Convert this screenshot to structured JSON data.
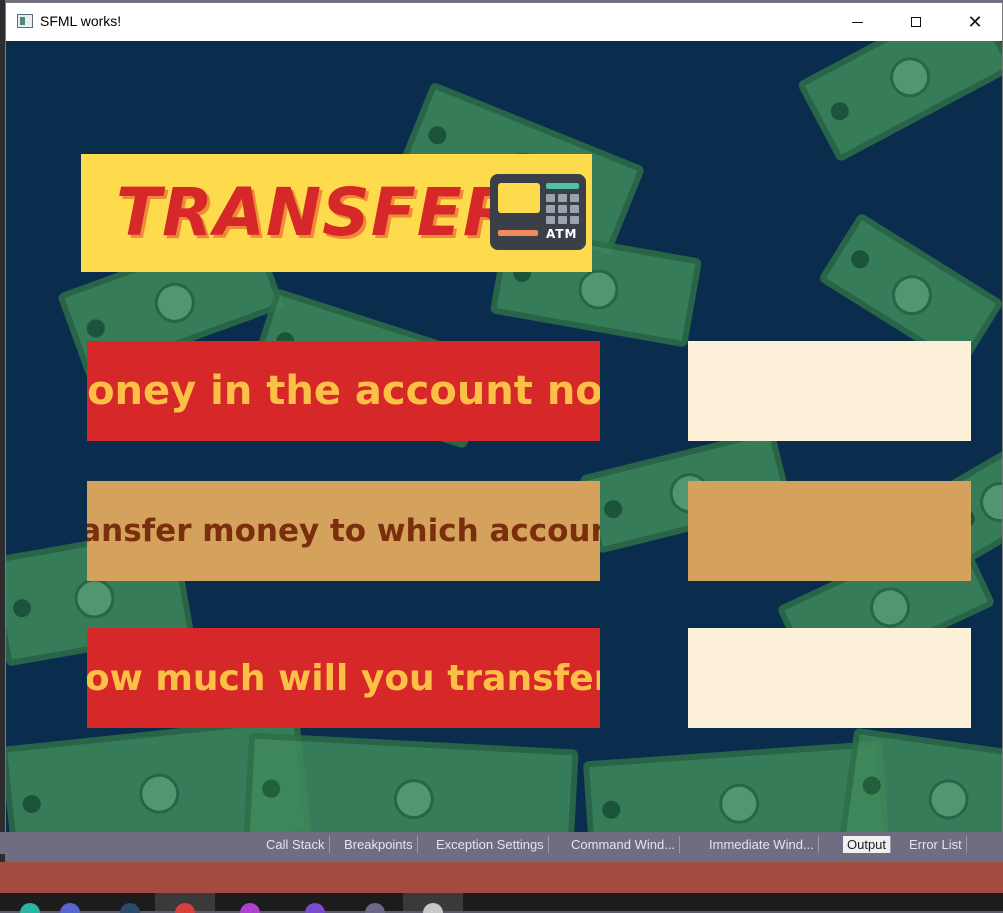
{
  "window": {
    "title": "SFML works!",
    "controls": {
      "minimize": "minimize",
      "maximize": "maximize",
      "close": "close"
    }
  },
  "header": {
    "title": "TRANSFER",
    "atm_label": "ATM"
  },
  "rows": [
    {
      "label": "Money in the account now",
      "value": ""
    },
    {
      "label": "Transfer money to which account:",
      "value": ""
    },
    {
      "label": "How much will you transfer?",
      "value": ""
    }
  ],
  "ide": {
    "tabs": [
      "Call Stack",
      "Breakpoints",
      "Exception Settings",
      "Command Wind...",
      "Immediate Wind...",
      "Output",
      "Error List"
    ],
    "active_tab": "Output"
  },
  "colors": {
    "canvas_bg": "#0b2d4d",
    "header_bg": "#fddb4d",
    "header_text": "#d62828",
    "red_box": "#d62828",
    "red_box_text": "#fcc046",
    "tan_box": "#d4a25c",
    "tan_box_text": "#7a2e0c",
    "input_cream": "#fdf0d8"
  },
  "icons": [
    "app-window-icon",
    "atm-icon",
    "minimize-icon",
    "maximize-icon",
    "close-icon"
  ]
}
